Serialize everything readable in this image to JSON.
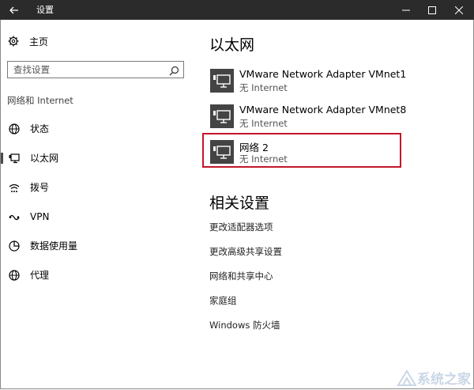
{
  "titlebar": {
    "title": "设置",
    "back_icon": "back-arrow-icon",
    "controls": [
      "minimize-icon",
      "maximize-icon",
      "close-icon"
    ]
  },
  "sidebar": {
    "home_label": "主页",
    "search_placeholder": "查找设置",
    "category": "网络和 Internet",
    "items": [
      {
        "label": "状态",
        "icon": "globe-icon"
      },
      {
        "label": "以太网",
        "icon": "ethernet-icon",
        "active": true
      },
      {
        "label": "拨号",
        "icon": "dialup-icon"
      },
      {
        "label": "VPN",
        "icon": "vpn-icon"
      },
      {
        "label": "数据使用量",
        "icon": "data-usage-icon"
      },
      {
        "label": "代理",
        "icon": "globe-icon"
      }
    ]
  },
  "main": {
    "heading": "以太网",
    "networks": [
      {
        "name": "VMware Network Adapter VMnet1",
        "status": "无 Internet"
      },
      {
        "name": "VMware Network Adapter VMnet8",
        "status": "无 Internet"
      },
      {
        "name": "网络  2",
        "status": "无 Internet"
      }
    ],
    "related_heading": "相关设置",
    "related_links": [
      "更改适配器选项",
      "更改高级共享设置",
      "网络和共享中心",
      "家庭组",
      "Windows 防火墙"
    ]
  },
  "colors": {
    "titlebar": "#2b2b2b",
    "highlight": "#c3152a"
  },
  "watermark": "系统之家"
}
